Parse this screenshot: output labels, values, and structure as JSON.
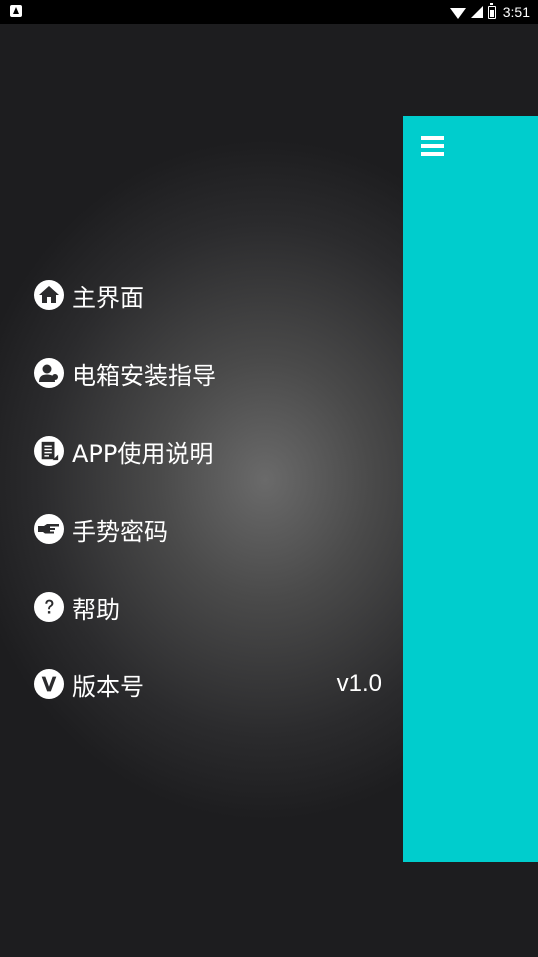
{
  "status_bar": {
    "time": "3:51"
  },
  "menu": {
    "items": [
      {
        "label": "主界面"
      },
      {
        "label": "电箱安装指导"
      },
      {
        "label": "APP使用说明"
      },
      {
        "label": "手势密码"
      },
      {
        "label": "帮助"
      },
      {
        "label": "版本号"
      }
    ],
    "version_value": "v1.0"
  },
  "colors": {
    "accent": "#00cdcd",
    "background": "#1c1c1e"
  },
  "icons": {
    "toggle": "hamburger-menu-icon",
    "home": "home-icon",
    "installation": "person-icon",
    "manual": "document-icon",
    "gesture": "pointing-hand-icon",
    "help": "question-mark-icon",
    "version": "letter-v-icon"
  }
}
